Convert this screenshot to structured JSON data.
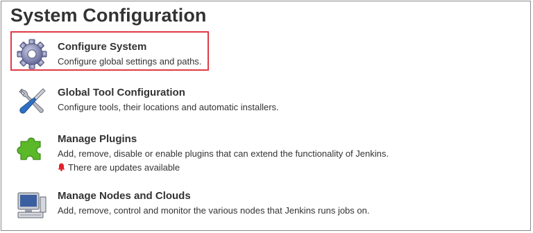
{
  "page": {
    "title": "System Configuration"
  },
  "items": [
    {
      "title": "Configure System",
      "description": "Configure global settings and paths.",
      "icon": "gear-icon"
    },
    {
      "title": "Global Tool Configuration",
      "description": "Configure tools, their locations and automatic installers.",
      "icon": "tools-icon"
    },
    {
      "title": "Manage Plugins",
      "description": "Add, remove, disable or enable plugins that can extend the functionality of Jenkins.",
      "icon": "puzzle-icon",
      "notice": "There are updates available"
    },
    {
      "title": "Manage Nodes and Clouds",
      "description": "Add, remove, control and monitor the various nodes that Jenkins runs jobs on.",
      "icon": "computer-icon"
    }
  ],
  "colors": {
    "highlight": "#e03a44",
    "notice_bell": "#e0222b",
    "plugin_green": "#5bb829"
  }
}
